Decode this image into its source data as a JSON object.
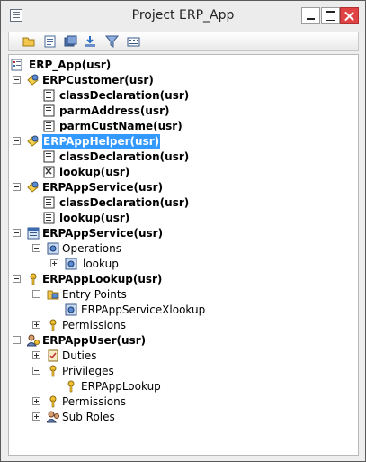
{
  "window": {
    "title": "Project ERP_App"
  },
  "toolbar": {
    "buttons": [
      "open-folder-icon",
      "properties-icon",
      "compile-icon",
      "export-icon",
      "filter-icon",
      "settings-icon"
    ]
  },
  "tree": {
    "root": {
      "label": "ERP_App(usr)"
    },
    "customer": {
      "label": "ERPCustomer(usr)",
      "children": [
        "classDeclaration(usr)",
        "parmAddress(usr)",
        "parmCustName(usr)"
      ]
    },
    "helper": {
      "label": "ERPAppHelper(usr)",
      "children": [
        "classDeclaration(usr)",
        "lookup(usr)"
      ]
    },
    "service_class": {
      "label": "ERPAppService(usr)",
      "children": [
        "classDeclaration(usr)",
        "lookup(usr)"
      ]
    },
    "service_group": {
      "label": "ERPAppService(usr)",
      "operations": {
        "label": "Operations",
        "children": [
          "lookup"
        ]
      }
    },
    "lookup_priv": {
      "label": "ERPAppLookup(usr)",
      "entry_points": {
        "label": "Entry Points",
        "children": [
          "ERPAppServiceXlookup"
        ]
      },
      "permissions": "Permissions"
    },
    "user_role": {
      "label": "ERPAppUser(usr)",
      "duties": "Duties",
      "privileges": {
        "label": "Privileges",
        "children": [
          "ERPAppLookup"
        ]
      },
      "permissions": "Permissions",
      "sub_roles": "Sub Roles"
    }
  },
  "colors": {
    "selection": "#3399ff",
    "close_button": "#e04343"
  }
}
